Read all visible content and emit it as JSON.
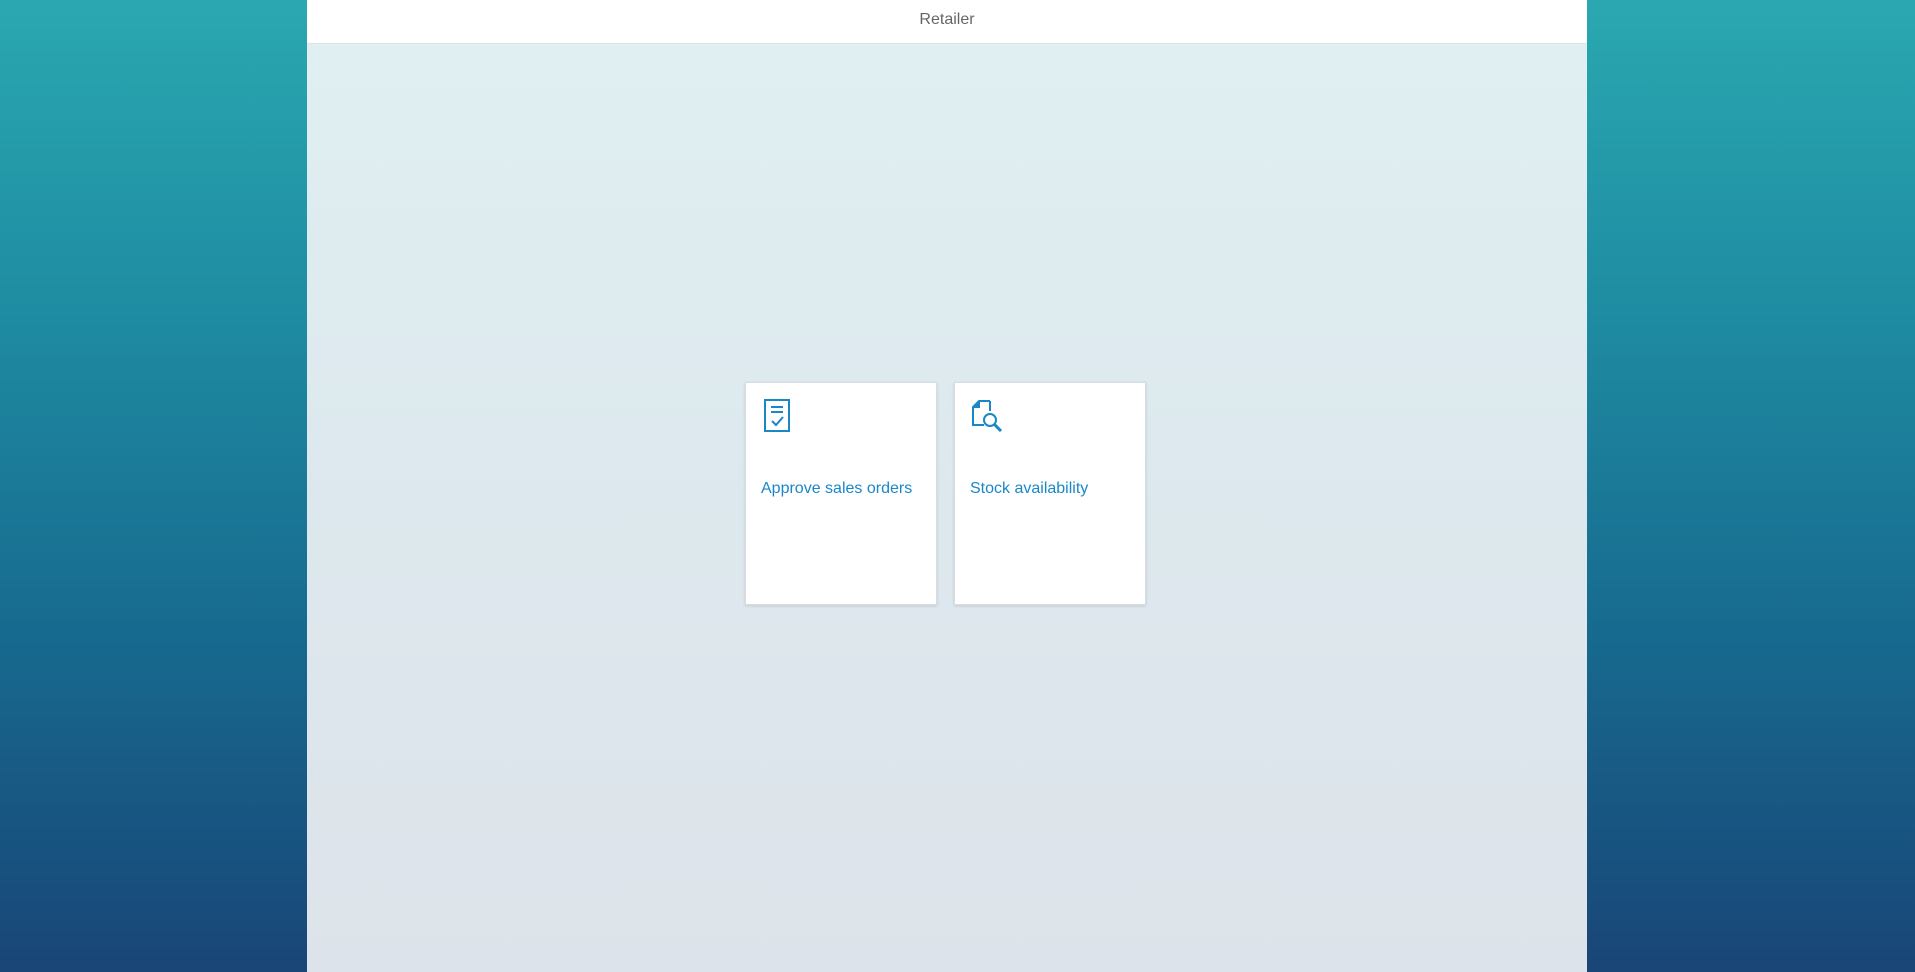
{
  "header": {
    "title": "Retailer"
  },
  "tiles": [
    {
      "title": "Approve sales orders",
      "icon": "approve-document-icon"
    },
    {
      "title": "Stock availability",
      "icon": "document-search-icon"
    }
  ],
  "colors": {
    "accent": "#1a87c9",
    "header_text": "#666666"
  }
}
